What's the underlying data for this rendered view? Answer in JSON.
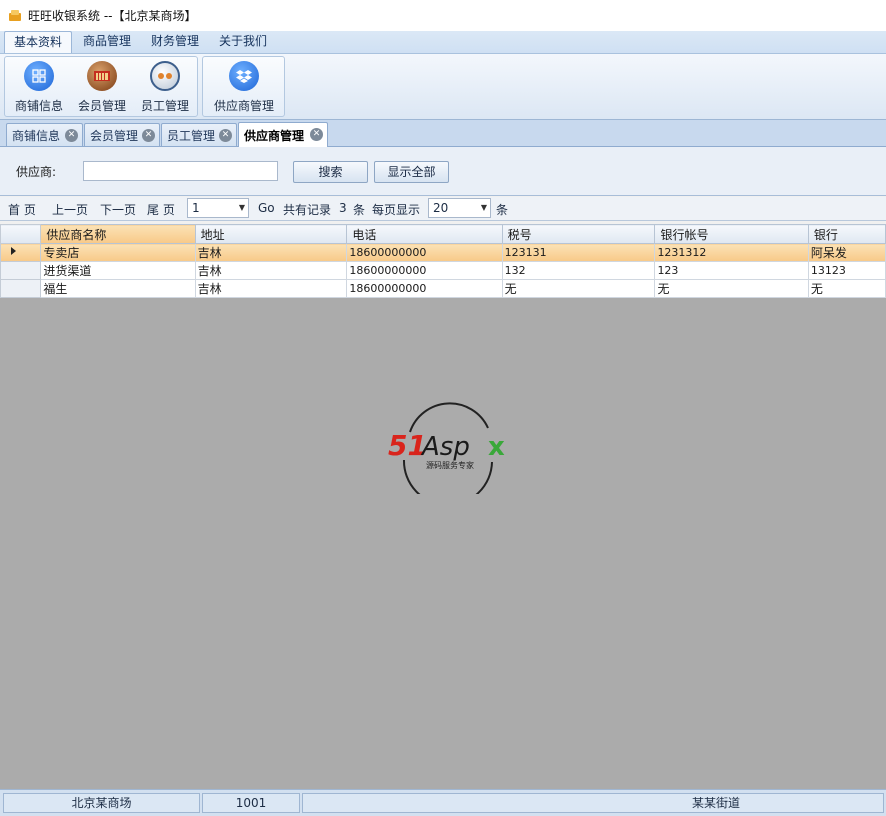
{
  "window": {
    "title": "旺旺收银系统 --【北京某商场】"
  },
  "menu": {
    "items": [
      "基本资料",
      "商品管理",
      "财务管理",
      "关于我们"
    ]
  },
  "ribbon": {
    "groups": [
      {
        "buttons": [
          "商铺信息",
          "会员管理",
          "员工管理"
        ]
      },
      {
        "buttons": [
          "供应商管理"
        ]
      }
    ]
  },
  "tabs": [
    "商铺信息",
    "会员管理",
    "员工管理",
    "供应商管理"
  ],
  "search": {
    "label": "供应商:",
    "value": "",
    "search_button": "搜索",
    "show_all_button": "显示全部"
  },
  "pager": {
    "first": "首 页",
    "prev": "上一页",
    "next": "下一页",
    "last": "尾 页",
    "page": "1",
    "go": "Go",
    "total_prefix": "共有记录",
    "total": "3",
    "total_suffix": "条",
    "per_page_label": "每页显示",
    "per_page": "20",
    "per_page_suffix": "条"
  },
  "grid": {
    "columns": [
      "供应商名称",
      "地址",
      "电话",
      "税号",
      "银行帐号",
      "银行"
    ],
    "rows": [
      [
        "专卖店",
        "吉林",
        "18600000000",
        "123131",
        "1231312",
        "阿呆发"
      ],
      [
        "进货渠道",
        "吉林",
        "18600000000",
        "132",
        "123",
        "13123"
      ],
      [
        "福生",
        "吉林",
        "18600000000",
        "无",
        "无",
        "无"
      ]
    ]
  },
  "watermark": {
    "brand": "51Aspx",
    "tagline": "源码服务专家"
  },
  "status": {
    "store": "北京某商场",
    "code": "1001",
    "address": "某某街道"
  }
}
